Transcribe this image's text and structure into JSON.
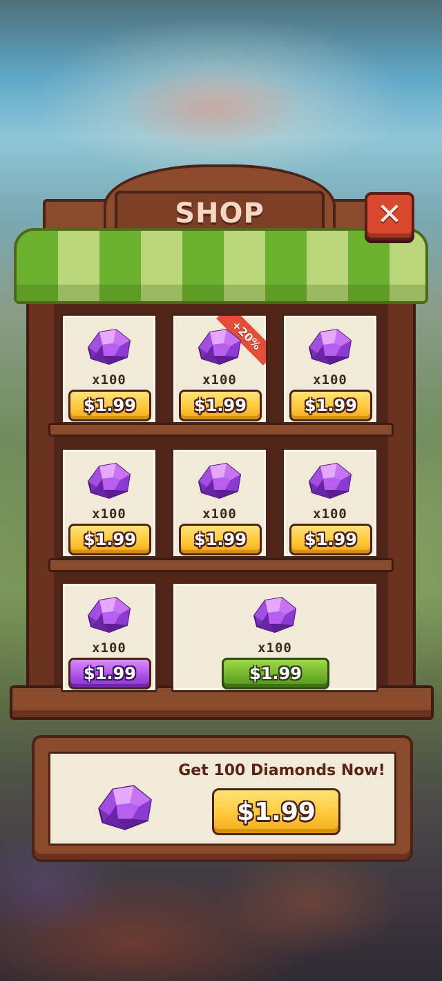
{
  "shop": {
    "title": "SHOP",
    "close_icon": "close-icon",
    "items": [
      {
        "icon": "gem-icon",
        "qty": "x100",
        "price": "$1.99",
        "style": "gold",
        "bonus": ""
      },
      {
        "icon": "gem-icon",
        "qty": "x100",
        "price": "$1.99",
        "style": "gold",
        "bonus": "+20%"
      },
      {
        "icon": "gem-icon",
        "qty": "x100",
        "price": "$1.99",
        "style": "gold",
        "bonus": ""
      },
      {
        "icon": "gem-icon",
        "qty": "x100",
        "price": "$1.99",
        "style": "gold",
        "bonus": ""
      },
      {
        "icon": "gem-icon",
        "qty": "x100",
        "price": "$1.99",
        "style": "gold",
        "bonus": ""
      },
      {
        "icon": "gem-icon",
        "qty": "x100",
        "price": "$1.99",
        "style": "gold",
        "bonus": ""
      },
      {
        "icon": "gem-icon",
        "qty": "x100",
        "price": "$1.99",
        "style": "purple",
        "bonus": ""
      },
      {
        "icon": "gem-icon",
        "qty": "x100",
        "price": "$1.99",
        "style": "green",
        "bonus": ""
      }
    ]
  },
  "offer": {
    "title": "Get 100 Diamonds Now!",
    "price": "$1.99",
    "icon": "gem-icon"
  },
  "colors": {
    "gold": "#ffc93a",
    "purple": "#a94ee6",
    "green": "#6fb22a",
    "wood": "#8a4a2c",
    "awning_green": "#6bb02e",
    "close_red": "#d9482f"
  }
}
